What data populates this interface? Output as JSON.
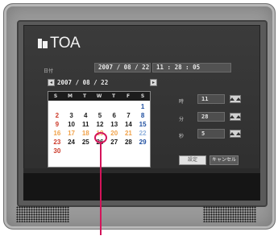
{
  "brand": {
    "logo_text": "TOA"
  },
  "datetime_row": {
    "label": "日付",
    "date": "2007 / 08 / 22",
    "time": "11 : 28 : 05"
  },
  "calendar": {
    "prev_glyph": "◂",
    "next_glyph": "▸",
    "header_date": "2007 / 08 / 22",
    "weekday_headers": [
      "S",
      "M",
      "T",
      "W",
      "T",
      "F",
      "S"
    ],
    "days": [
      "",
      "",
      "",
      "",
      "",
      "",
      "1",
      "2",
      "3",
      "4",
      "5",
      "6",
      "7",
      "8",
      "9",
      "10",
      "11",
      "12",
      "13",
      "14",
      "15",
      "16",
      "17",
      "18",
      "19",
      "20",
      "21",
      "22",
      "23",
      "24",
      "25",
      "26",
      "27",
      "28",
      "29",
      "30",
      "",
      "",
      "",
      "",
      "",
      ""
    ],
    "highlighted_day": "19"
  },
  "time_fields": [
    {
      "label": "時",
      "value": "11"
    },
    {
      "label": "分",
      "value": "28"
    },
    {
      "label": "秒",
      "value": "5"
    }
  ],
  "buttons": {
    "ok_label": "設定",
    "cancel_label": "キャンセル"
  },
  "colors": {
    "callout": "#d4145a",
    "sunday": "#cc3a2a",
    "saturday": "#1f4fa0",
    "selected_range": "#f0a24a"
  }
}
